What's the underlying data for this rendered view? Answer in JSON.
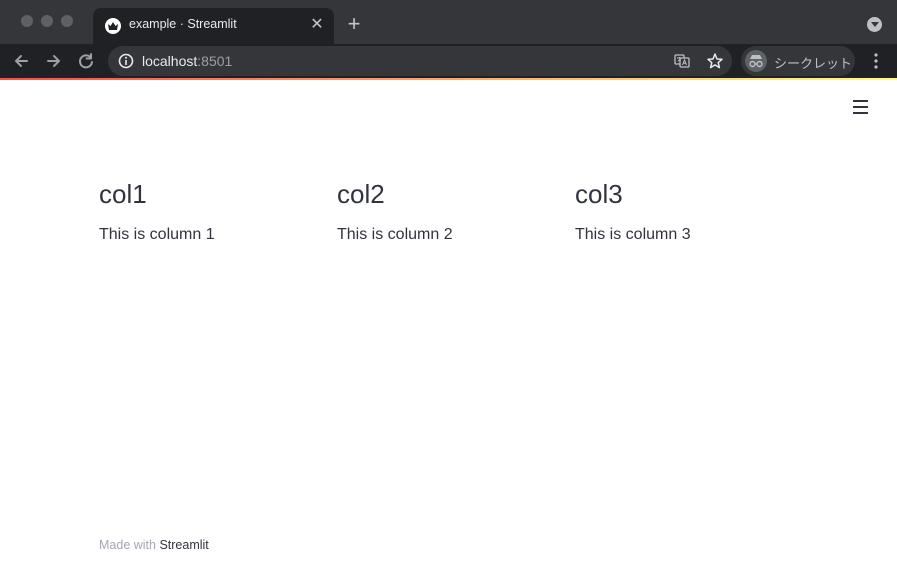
{
  "browser": {
    "tab_title": "example · Streamlit",
    "new_tab_symbol": "+",
    "close_symbol": "✕",
    "url_host": "localhost",
    "url_port": ":8501",
    "incognito_label": "シークレット"
  },
  "icons": {
    "favicon": "streamlit-crown-icon",
    "back": "arrow-left-icon",
    "forward": "arrow-right-icon",
    "reload": "reload-icon",
    "info": "info-icon",
    "translate": "translate-icon",
    "bookmark": "star-icon",
    "incognito": "incognito-icon",
    "menu": "kebab-icon",
    "app_menu": "hamburger-icon"
  },
  "colors": {
    "accent_gradient_start": "#ff4b4b",
    "accent_gradient_end": "#fffd80",
    "text": "#31333f",
    "muted": "#a3a8b4"
  },
  "columns": [
    {
      "heading": "col1",
      "text": "This is column 1"
    },
    {
      "heading": "col2",
      "text": "This is column 2"
    },
    {
      "heading": "col3",
      "text": "This is column 3"
    }
  ],
  "footer": {
    "prefix": "Made with ",
    "link": "Streamlit"
  }
}
